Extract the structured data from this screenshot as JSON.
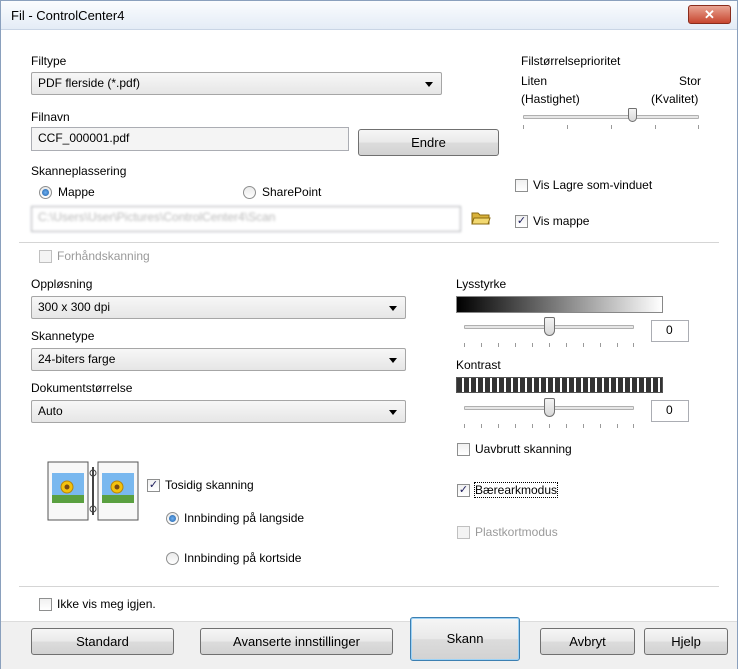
{
  "window": {
    "title": "Fil - ControlCenter4",
    "close_label": "✕"
  },
  "file_type": {
    "label": "Filtype",
    "value": "PDF flerside (*.pdf)"
  },
  "file_size": {
    "label": "Filstørrelseprioritet",
    "left_label": "Liten",
    "left_sub": "(Hastighet)",
    "right_label": "Stor",
    "right_sub": "(Kvalitet)",
    "level_percent": 62
  },
  "file_name": {
    "label": "Filnavn",
    "value": "CCF_000001.pdf",
    "change_button": "Endre"
  },
  "scan_location": {
    "label": "Skanneplassering",
    "option_folder": "Mappe",
    "option_sharepoint": "SharePoint",
    "path_value": "C:\\Users\\User\\Pictures\\ControlCenter4\\Scan"
  },
  "show_save_as": {
    "label": "Vis Lagre som-vinduet",
    "checked": false
  },
  "show_folder": {
    "label": "Vis mappe",
    "checked": true
  },
  "prescan": {
    "label": "Forhåndskanning",
    "checked": false
  },
  "resolution": {
    "label": "Oppløsning",
    "value": "300 x 300 dpi"
  },
  "scan_type": {
    "label": "Skannetype",
    "value": "24-biters farge"
  },
  "doc_size": {
    "label": "Dokumentstørrelse",
    "value": "Auto"
  },
  "brightness": {
    "label": "Lysstyrke",
    "value": "0",
    "level_percent": 50
  },
  "contrast": {
    "label": "Kontrast",
    "value": "0",
    "level_percent": 50
  },
  "continuous_scan": {
    "label": "Uavbrutt skanning",
    "checked": false
  },
  "carrier_sheet": {
    "label": "Bærearkmodus",
    "checked": true
  },
  "plastic_card": {
    "label": "Plastkortmodus",
    "checked": false
  },
  "duplex": {
    "label": "Tosidig skanning",
    "checked": true,
    "long_edge": "Innbinding på langside",
    "short_edge": "Innbinding på kortside"
  },
  "dont_show_again": {
    "label": "Ikke vis meg igjen.",
    "checked": false
  },
  "footer_buttons": {
    "standard": "Standard",
    "advanced": "Avanserte innstillinger",
    "scan": "Skann",
    "cancel": "Avbryt",
    "help": "Hjelp"
  },
  "colors": {
    "accent_radio": "#1d5fa8",
    "close_button": "#c7462f",
    "folder_icon": "#e8c54a"
  }
}
